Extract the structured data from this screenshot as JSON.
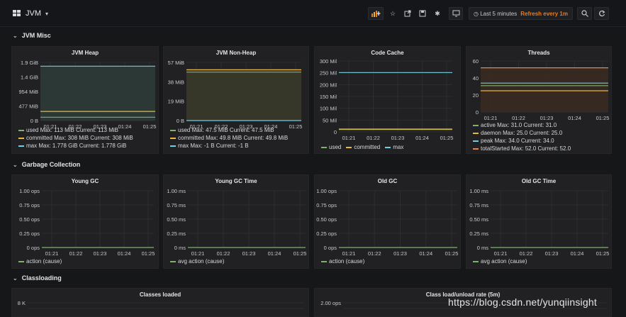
{
  "header": {
    "title": "JVM",
    "time_range": "Last 5 minutes",
    "refresh": "Refresh every 1m"
  },
  "rows": [
    {
      "title": "JVM Misc"
    },
    {
      "title": "Garbage Collection"
    },
    {
      "title": "Classloading"
    }
  ],
  "x_times": [
    "01:21",
    "01:22",
    "01:23",
    "01:24",
    "01:25"
  ],
  "colors": {
    "green": "#7eb26d",
    "yellow": "#eab839",
    "blue": "#6ed0e0",
    "orange": "#ef843c",
    "red": "#e24d42",
    "accent": "#eb7b18"
  },
  "panels": [
    {
      "id": "jvm-heap",
      "title": "JVM Heap",
      "chart_data": {
        "type": "line",
        "x": [
          "01:21",
          "01:22",
          "01:23",
          "01:24",
          "01:25"
        ],
        "yticks": [
          "1.9 GiB",
          "1.4 GiB",
          "954 MiB",
          "477 MiB",
          "0 B"
        ],
        "ylim_gib": [
          0,
          1.9
        ],
        "series": [
          {
            "name": "used",
            "color": "#7eb26d",
            "values_gib": [
              0.11,
              0.11,
              0.11,
              0.11,
              0.11
            ]
          },
          {
            "name": "committed",
            "color": "#eab839",
            "values_gib": [
              0.3,
              0.3,
              0.3,
              0.3,
              0.3
            ]
          },
          {
            "name": "max",
            "color": "#6ed0e0",
            "values_gib": [
              1.778,
              1.778,
              1.778,
              1.778,
              1.778
            ]
          }
        ]
      },
      "legend": [
        "used Max: 113 MiB Current: 113 MiB",
        "committed Max: 308 MiB Current: 308 MiB",
        "max Max: 1.778 GiB Current: 1.778 GiB"
      ]
    },
    {
      "id": "jvm-non-heap",
      "title": "JVM Non-Heap",
      "chart_data": {
        "type": "line",
        "x": [
          "01:21",
          "01:22",
          "01:23",
          "01:24",
          "01:25"
        ],
        "yticks": [
          "57 MiB",
          "38 MiB",
          "19 MiB",
          "0 B"
        ],
        "ylim_mib": [
          0,
          57
        ],
        "series": [
          {
            "name": "used",
            "color": "#7eb26d",
            "values_mib": [
              47.5,
              47.5,
              47.5,
              47.5,
              47.5
            ]
          },
          {
            "name": "committed",
            "color": "#eab839",
            "values_mib": [
              49.8,
              49.8,
              49.8,
              49.8,
              49.8
            ]
          },
          {
            "name": "max",
            "color": "#6ed0e0",
            "values_mib": [
              -1,
              -1,
              -1,
              -1,
              -1
            ]
          }
        ]
      },
      "legend": [
        "used Max: 47.5 MiB Current: 47.5 MiB",
        "committed Max: 49.8 MiB Current: 49.8 MiB",
        "max Max: -1 B Current: -1 B"
      ]
    },
    {
      "id": "code-cache",
      "title": "Code Cache",
      "chart_data": {
        "type": "line",
        "x": [
          "01:21",
          "01:22",
          "01:23",
          "01:24",
          "01:25"
        ],
        "yticks": [
          "300 Mil",
          "250 Mil",
          "200 Mil",
          "150 Mil",
          "100 Mil",
          "50 Mil",
          "0"
        ],
        "ylim": [
          0,
          300
        ],
        "series": [
          {
            "name": "used",
            "color": "#7eb26d",
            "values": [
              10,
              10,
              10,
              10,
              10
            ]
          },
          {
            "name": "committed",
            "color": "#eab839",
            "values": [
              12,
              12,
              12,
              12,
              12
            ]
          },
          {
            "name": "max",
            "color": "#6ed0e0",
            "values": [
              251,
              251,
              251,
              251,
              251
            ]
          }
        ]
      },
      "legend": [
        "used",
        "committed",
        "max"
      ]
    },
    {
      "id": "threads",
      "title": "Threads",
      "chart_data": {
        "type": "line",
        "x": [
          "01:21",
          "01:22",
          "01:23",
          "01:24",
          "01:25"
        ],
        "yticks": [
          "60",
          "40",
          "20",
          "0"
        ],
        "ylim": [
          0,
          60
        ],
        "series": [
          {
            "name": "active",
            "color": "#7eb26d",
            "values": [
              31,
              31,
              31,
              31,
              31
            ]
          },
          {
            "name": "daemon",
            "color": "#eab839",
            "values": [
              25,
              25,
              25,
              25,
              25
            ]
          },
          {
            "name": "peak",
            "color": "#6ed0e0",
            "values": [
              34,
              34,
              34,
              34,
              34
            ]
          },
          {
            "name": "totalStarted",
            "color": "#ef843c",
            "values": [
              52,
              52,
              52,
              52,
              52
            ]
          }
        ]
      },
      "legend": [
        "active Max: 31.0 Current: 31.0",
        "daemon Max: 25.0 Current: 25.0",
        "peak Max: 34.0 Current: 34.0",
        "totalStarted Max: 52.0 Current: 52.0"
      ]
    },
    {
      "id": "young-gc",
      "title": "Young GC",
      "chart_data": {
        "type": "line",
        "x": [
          "01:21",
          "01:22",
          "01:23",
          "01:24",
          "01:25"
        ],
        "yticks": [
          "1.00 ops",
          "0.75 ops",
          "0.50 ops",
          "0.25 ops",
          "0 ops"
        ],
        "ylim": [
          0,
          1
        ],
        "series": [
          {
            "name": "action (cause)",
            "color": "#7eb26d",
            "values": [
              0,
              0,
              0,
              0,
              0
            ]
          }
        ]
      },
      "legend": [
        "action (cause)"
      ]
    },
    {
      "id": "young-gc-time",
      "title": "Young GC Time",
      "chart_data": {
        "type": "line",
        "x": [
          "01:21",
          "01:22",
          "01:23",
          "01:24",
          "01:25"
        ],
        "yticks": [
          "1.00 ms",
          "0.75 ms",
          "0.50 ms",
          "0.25 ms",
          "0 ms"
        ],
        "ylim": [
          0,
          1
        ],
        "series": [
          {
            "name": "avg action (cause)",
            "color": "#7eb26d",
            "values": [
              0,
              0,
              0,
              0,
              0
            ]
          }
        ]
      },
      "legend": [
        "avg action (cause)"
      ]
    },
    {
      "id": "old-gc",
      "title": "Old GC",
      "chart_data": {
        "type": "line",
        "x": [
          "01:21",
          "01:22",
          "01:23",
          "01:24",
          "01:25"
        ],
        "yticks": [
          "1.00 ops",
          "0.75 ops",
          "0.50 ops",
          "0.25 ops",
          "0 ops"
        ],
        "ylim": [
          0,
          1
        ],
        "series": [
          {
            "name": "action (cause)",
            "color": "#7eb26d",
            "values": [
              0,
              0,
              0,
              0,
              0
            ]
          }
        ]
      },
      "legend": [
        "action (cause)"
      ]
    },
    {
      "id": "old-gc-time",
      "title": "Old GC Time",
      "chart_data": {
        "type": "line",
        "x": [
          "01:21",
          "01:22",
          "01:23",
          "01:24",
          "01:25"
        ],
        "yticks": [
          "1.00 ms",
          "0.75 ms",
          "0.50 ms",
          "0.25 ms",
          "0 ms"
        ],
        "ylim": [
          0,
          1
        ],
        "series": [
          {
            "name": "avg action (cause)",
            "color": "#7eb26d",
            "values": [
              0,
              0,
              0,
              0,
              0
            ]
          }
        ]
      },
      "legend": [
        "avg action (cause)"
      ]
    },
    {
      "id": "classes-loaded",
      "title": "Classes loaded",
      "chart_data": {
        "type": "line",
        "yticks": [
          "8 K"
        ]
      },
      "legend": []
    },
    {
      "id": "class-load-unload-rate",
      "title": "Class load/unload rate (5m)",
      "chart_data": {
        "type": "line",
        "yticks": [
          "2.00 ops"
        ]
      },
      "legend": []
    }
  ],
  "watermark": "https://blog.csdn.net/yunqiinsight"
}
